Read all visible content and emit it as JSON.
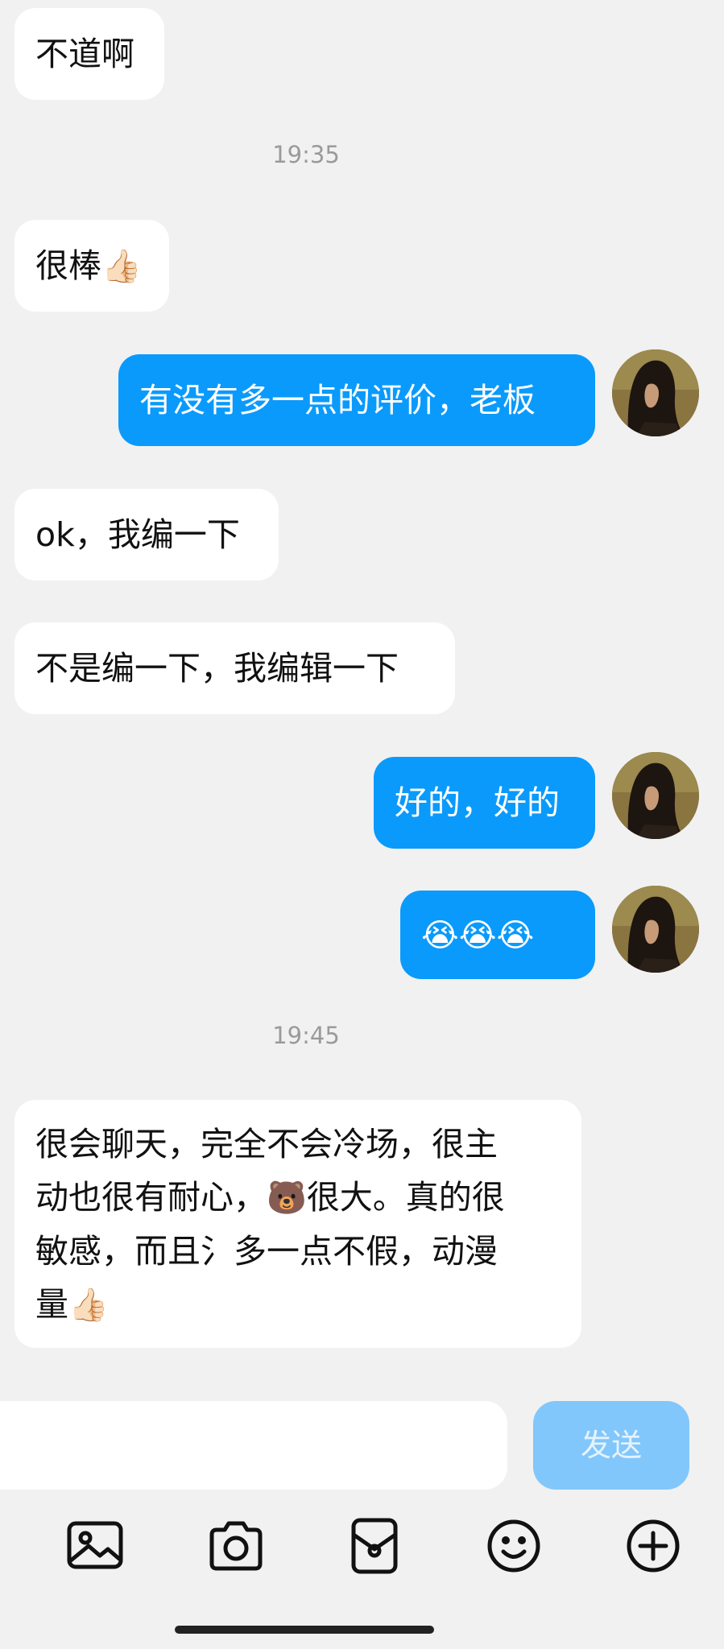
{
  "messages": [
    {
      "side": "in",
      "text": "不道啊"
    },
    {
      "timestamp": "19:35"
    },
    {
      "side": "in",
      "text": "很棒",
      "emoji": "👍🏻"
    },
    {
      "side": "out",
      "text": "有没有多一点的评价，老板"
    },
    {
      "side": "in",
      "text": "ok，我编一下"
    },
    {
      "side": "in",
      "text": "不是编一下，我编辑一下"
    },
    {
      "side": "out",
      "text": "好的，好的"
    },
    {
      "side": "out",
      "emoji": "😭😭😭"
    },
    {
      "timestamp": "19:45"
    },
    {
      "side": "in",
      "line1": "很会聊天，完全不会冷场，很主",
      "line2a": "动也很有耐心，",
      "line2_emoji": "🐻",
      "line2b": "很大。真的很",
      "line3": "敏感，而且氵多一点不假，动漫",
      "line4": "量",
      "line4_emoji": "👍🏻"
    }
  ],
  "composer": {
    "input_value": "",
    "send_label": "发送"
  },
  "toolbar": [
    "image-icon",
    "camera-icon",
    "sticker-icon",
    "emoji-smile-icon",
    "plus-circle-icon"
  ],
  "colors": {
    "background": "#f1f1f1",
    "incoming_bubble": "#ffffff",
    "outgoing_bubble": "#0a9afc",
    "send_button_disabled": "#82c7fb"
  }
}
